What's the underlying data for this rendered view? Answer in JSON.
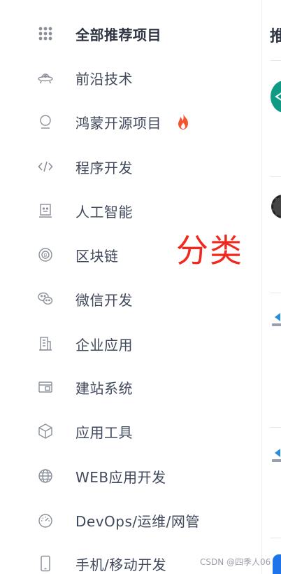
{
  "categories": [
    {
      "label": "全部推荐项目",
      "icon": "grid-dots-icon",
      "active": true
    },
    {
      "label": "前沿技术",
      "icon": "ufo-icon"
    },
    {
      "label": "鸿蒙开源项目",
      "icon": "harmony-icon",
      "badge": "hot-flame-icon"
    },
    {
      "label": "程序开发",
      "icon": "code-icon"
    },
    {
      "label": "人工智能",
      "icon": "robot-icon"
    },
    {
      "label": "区块链",
      "icon": "blockchain-icon"
    },
    {
      "label": "微信开发",
      "icon": "wechat-icon"
    },
    {
      "label": "企业应用",
      "icon": "building-icon"
    },
    {
      "label": "建站系统",
      "icon": "browser-window-icon"
    },
    {
      "label": "应用工具",
      "icon": "cube-icon"
    },
    {
      "label": "WEB应用开发",
      "icon": "globe-icon"
    },
    {
      "label": "DevOps/运维/网管",
      "icon": "gauge-icon"
    },
    {
      "label": "手机/移动开发",
      "icon": "mobile-phone-icon"
    }
  ],
  "annotation": "分类",
  "right_panel": {
    "title": "推"
  },
  "watermark": "CSDN @四季人06",
  "colors": {
    "text": "#40485b",
    "icon": "#8a8f99",
    "hot": "#f5542d",
    "annotation": "#f0281e",
    "accent_teal": "#0e9a83",
    "accent_blue": "#1e74e8"
  }
}
